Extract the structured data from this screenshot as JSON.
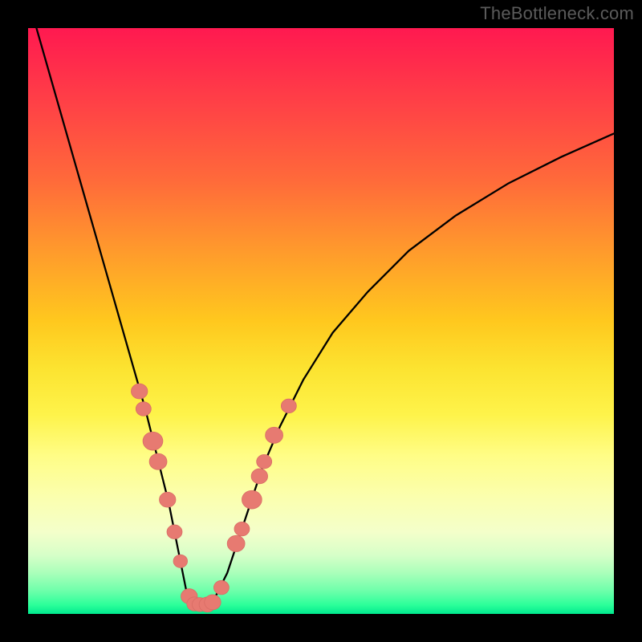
{
  "watermark": "TheBottleneck.com",
  "colors": {
    "frame": "#000000",
    "curve": "#000000",
    "marker_fill": "#e77a71",
    "marker_stroke": "#d96d65"
  },
  "chart_data": {
    "type": "line",
    "title": "",
    "xlabel": "",
    "ylabel": "",
    "xlim": [
      0,
      100
    ],
    "ylim": [
      0,
      100
    ],
    "grid": false,
    "legend": false,
    "series": [
      {
        "name": "curve",
        "x": [
          0,
          2,
          4,
          6,
          8,
          10,
          12,
          14,
          16,
          18,
          20,
          22,
          23,
          24,
          25,
          26,
          27,
          28,
          29,
          30,
          31,
          32,
          34,
          36,
          38,
          40,
          43,
          47,
          52,
          58,
          65,
          73,
          82,
          91,
          100
        ],
        "y": [
          105,
          98,
          91,
          84,
          77,
          70,
          63,
          56,
          49,
          42,
          35,
          27,
          23,
          19,
          14,
          9,
          4,
          2,
          1.6,
          1.6,
          1.6,
          3,
          7,
          13,
          19,
          25,
          32,
          40,
          48,
          55,
          62,
          68,
          73.5,
          78,
          82
        ]
      }
    ],
    "markers": [
      {
        "x": 19.0,
        "y": 38.0,
        "r": 1.4
      },
      {
        "x": 19.7,
        "y": 35.0,
        "r": 1.3
      },
      {
        "x": 21.3,
        "y": 29.5,
        "r": 1.7
      },
      {
        "x": 22.2,
        "y": 26.0,
        "r": 1.5
      },
      {
        "x": 23.8,
        "y": 19.5,
        "r": 1.4
      },
      {
        "x": 25.0,
        "y": 14.0,
        "r": 1.3
      },
      {
        "x": 26.0,
        "y": 9.0,
        "r": 1.2
      },
      {
        "x": 27.5,
        "y": 3.0,
        "r": 1.4
      },
      {
        "x": 28.4,
        "y": 1.7,
        "r": 1.3
      },
      {
        "x": 29.3,
        "y": 1.6,
        "r": 1.3
      },
      {
        "x": 30.6,
        "y": 1.6,
        "r": 1.4
      },
      {
        "x": 31.5,
        "y": 2.0,
        "r": 1.4
      },
      {
        "x": 33.0,
        "y": 4.5,
        "r": 1.3
      },
      {
        "x": 35.5,
        "y": 12.0,
        "r": 1.5
      },
      {
        "x": 36.5,
        "y": 14.5,
        "r": 1.3
      },
      {
        "x": 38.2,
        "y": 19.5,
        "r": 1.7
      },
      {
        "x": 39.5,
        "y": 23.5,
        "r": 1.4
      },
      {
        "x": 40.3,
        "y": 26.0,
        "r": 1.3
      },
      {
        "x": 42.0,
        "y": 30.5,
        "r": 1.5
      },
      {
        "x": 44.5,
        "y": 35.5,
        "r": 1.3
      }
    ]
  }
}
